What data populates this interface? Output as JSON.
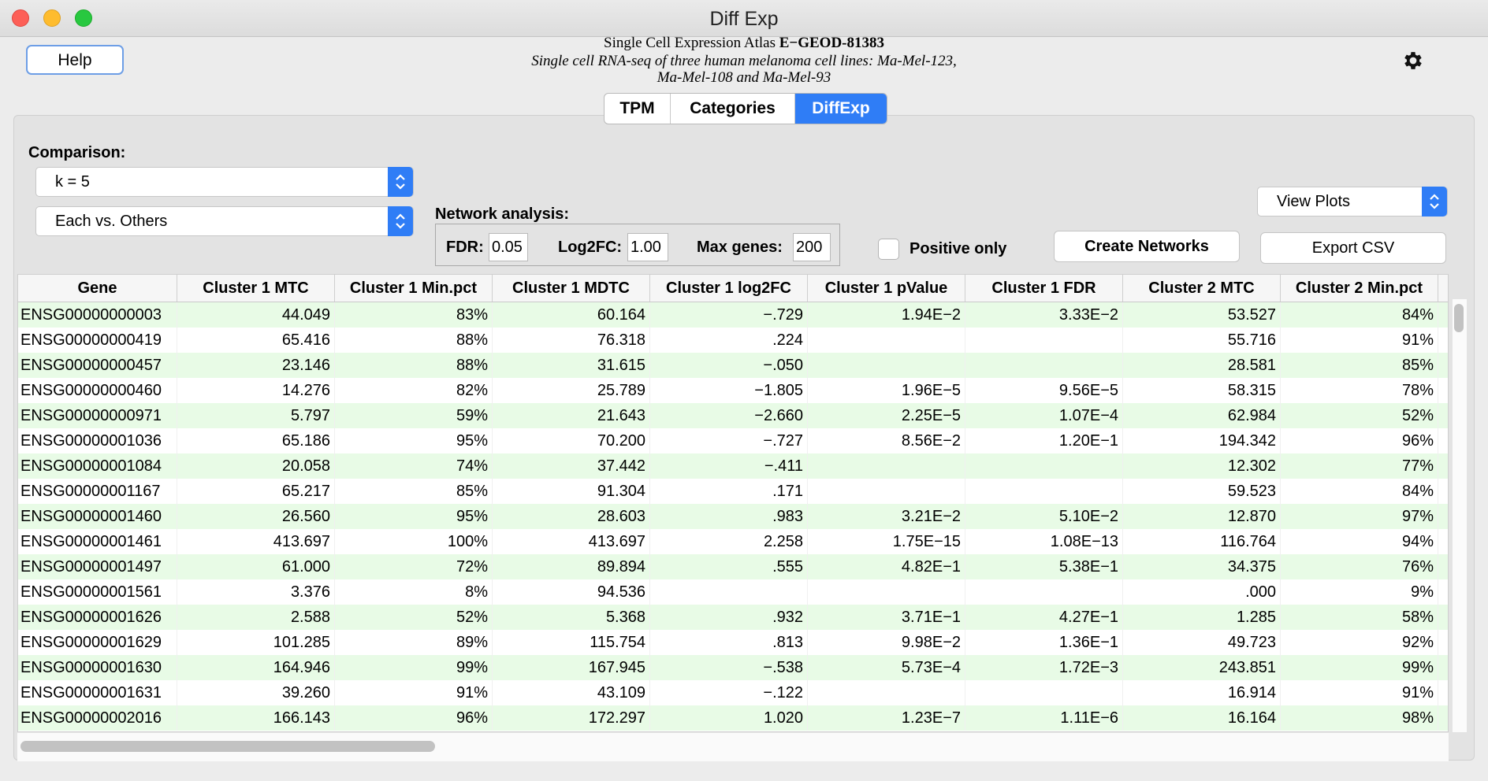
{
  "window": {
    "title": "Diff Exp"
  },
  "help_label": "Help",
  "header": {
    "line1_prefix": "Single Cell Expression Atlas ",
    "line1_id": "E-GEOD-81383",
    "line2": "Single cell RNA-seq of three human melanoma cell lines: Ma-Mel-123,",
    "line3": "Ma-Mel-108 and Ma-Mel-93"
  },
  "tabs": [
    {
      "label": "TPM",
      "active": false
    },
    {
      "label": "Categories",
      "active": false
    },
    {
      "label": "DiffExp",
      "active": true
    }
  ],
  "comparison": {
    "label": "Comparison:",
    "k_value": "k = 5",
    "mode_value": "Each vs. Others"
  },
  "network": {
    "label": "Network analysis:",
    "fdr_label": "FDR:",
    "fdr_value": "0.05",
    "log2fc_label": "Log2FC:",
    "log2fc_value": "1.00",
    "maxgenes_label": "Max genes:",
    "maxgenes_value": "200"
  },
  "positive_only": {
    "label": "Positive only",
    "checked": false
  },
  "buttons": {
    "create_networks": "Create Networks",
    "view_plots": "View Plots",
    "export_csv": "Export CSV"
  },
  "table": {
    "columns": [
      "Gene",
      "Cluster 1 MTC",
      "Cluster 1 Min.pct",
      "Cluster 1 MDTC",
      "Cluster 1 log2FC",
      "Cluster 1 pValue",
      "Cluster 1 FDR",
      "Cluster 2 MTC",
      "Cluster 2 Min.pct"
    ],
    "rows": [
      [
        "ENSG00000000003",
        "44.049",
        "83%",
        "60.164",
        "-.729",
        "1.94E-2",
        "3.33E-2",
        "53.527",
        "84%"
      ],
      [
        "ENSG00000000419",
        "65.416",
        "88%",
        "76.318",
        ".224",
        "",
        "",
        "55.716",
        "91%"
      ],
      [
        "ENSG00000000457",
        "23.146",
        "88%",
        "31.615",
        "-.050",
        "",
        "",
        "28.581",
        "85%"
      ],
      [
        "ENSG00000000460",
        "14.276",
        "82%",
        "25.789",
        "-1.805",
        "1.96E-5",
        "9.56E-5",
        "58.315",
        "78%"
      ],
      [
        "ENSG00000000971",
        "5.797",
        "59%",
        "21.643",
        "-2.660",
        "2.25E-5",
        "1.07E-4",
        "62.984",
        "52%"
      ],
      [
        "ENSG00000001036",
        "65.186",
        "95%",
        "70.200",
        "-.727",
        "8.56E-2",
        "1.20E-1",
        "194.342",
        "96%"
      ],
      [
        "ENSG00000001084",
        "20.058",
        "74%",
        "37.442",
        "-.411",
        "",
        "",
        "12.302",
        "77%"
      ],
      [
        "ENSG00000001167",
        "65.217",
        "85%",
        "91.304",
        ".171",
        "",
        "",
        "59.523",
        "84%"
      ],
      [
        "ENSG00000001460",
        "26.560",
        "95%",
        "28.603",
        ".983",
        "3.21E-2",
        "5.10E-2",
        "12.870",
        "97%"
      ],
      [
        "ENSG00000001461",
        "413.697",
        "100%",
        "413.697",
        "2.258",
        "1.75E-15",
        "1.08E-13",
        "116.764",
        "94%"
      ],
      [
        "ENSG00000001497",
        "61.000",
        "72%",
        "89.894",
        ".555",
        "4.82E-1",
        "5.38E-1",
        "34.375",
        "76%"
      ],
      [
        "ENSG00000001561",
        "3.376",
        "8%",
        "94.536",
        "",
        "",
        "",
        ".000",
        "9%"
      ],
      [
        "ENSG00000001626",
        "2.588",
        "52%",
        "5.368",
        ".932",
        "3.71E-1",
        "4.27E-1",
        "1.285",
        "58%"
      ],
      [
        "ENSG00000001629",
        "101.285",
        "89%",
        "115.754",
        ".813",
        "9.98E-2",
        "1.36E-1",
        "49.723",
        "92%"
      ],
      [
        "ENSG00000001630",
        "164.946",
        "99%",
        "167.945",
        "-.538",
        "5.73E-4",
        "1.72E-3",
        "243.851",
        "99%"
      ],
      [
        "ENSG00000001631",
        "39.260",
        "91%",
        "43.109",
        "-.122",
        "",
        "",
        "16.914",
        "91%"
      ],
      [
        "ENSG00000002016",
        "166.143",
        "96%",
        "172.297",
        "1.020",
        "1.23E-7",
        "1.11E-6",
        "16.164",
        "98%"
      ]
    ]
  },
  "colors": {
    "accent": "#2f7df6",
    "row_alt": "#e8fbe6"
  }
}
